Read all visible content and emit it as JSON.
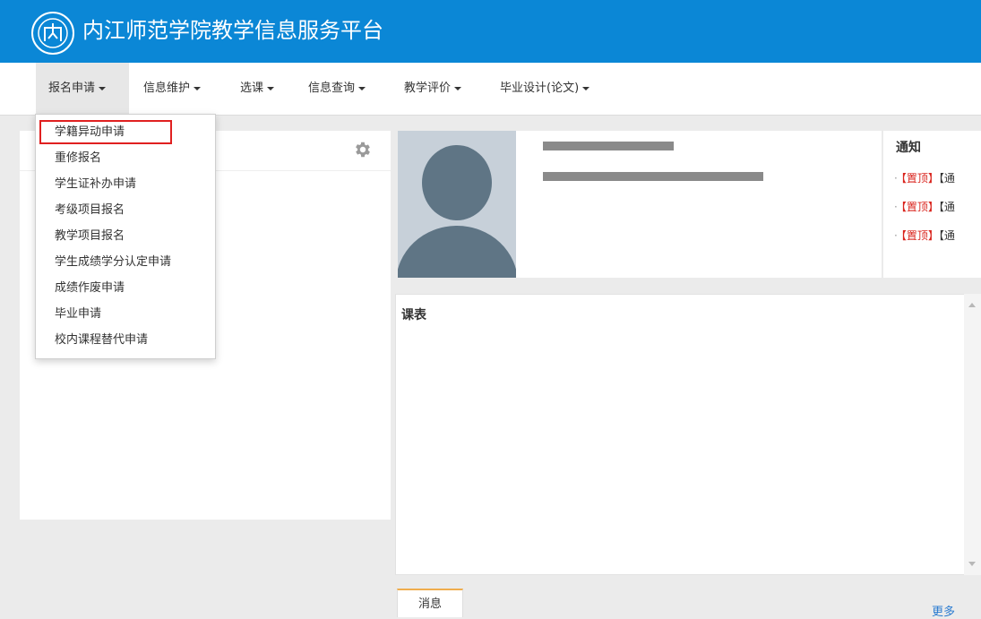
{
  "header": {
    "title": "内江师范学院教学信息服务平台",
    "brand_color": "#0b87d6"
  },
  "nav": {
    "items": [
      {
        "label": "报名申请"
      },
      {
        "label": "信息维护"
      },
      {
        "label": "选课"
      },
      {
        "label": "信息查询"
      },
      {
        "label": "教学评价"
      },
      {
        "label": "毕业设计(论文)"
      }
    ]
  },
  "dropdown": {
    "items": [
      {
        "label": "学籍异动申请"
      },
      {
        "label": "重修报名"
      },
      {
        "label": "学生证补办申请"
      },
      {
        "label": "考级项目报名"
      },
      {
        "label": "教学项目报名"
      },
      {
        "label": "学生成绩学分认定申请"
      },
      {
        "label": "成绩作废申请"
      },
      {
        "label": "毕业申请"
      },
      {
        "label": "校内课程替代申请"
      }
    ],
    "highlight_color": "#e02020"
  },
  "notice": {
    "title": "通知",
    "items": [
      {
        "bullet": "·",
        "tag": "【置顶】",
        "text": "【通"
      },
      {
        "bullet": "·",
        "tag": "【置顶】",
        "text": "【通"
      },
      {
        "bullet": "·",
        "tag": "【置顶】",
        "text": "【通"
      }
    ],
    "tag_color": "#d9231c"
  },
  "schedule": {
    "title": "课表"
  },
  "messages": {
    "tab_label": "消息",
    "more_label": "更多"
  },
  "icons": {
    "gear": "gear-icon",
    "logo": "logo-icon",
    "avatar": "avatar-placeholder-icon"
  }
}
